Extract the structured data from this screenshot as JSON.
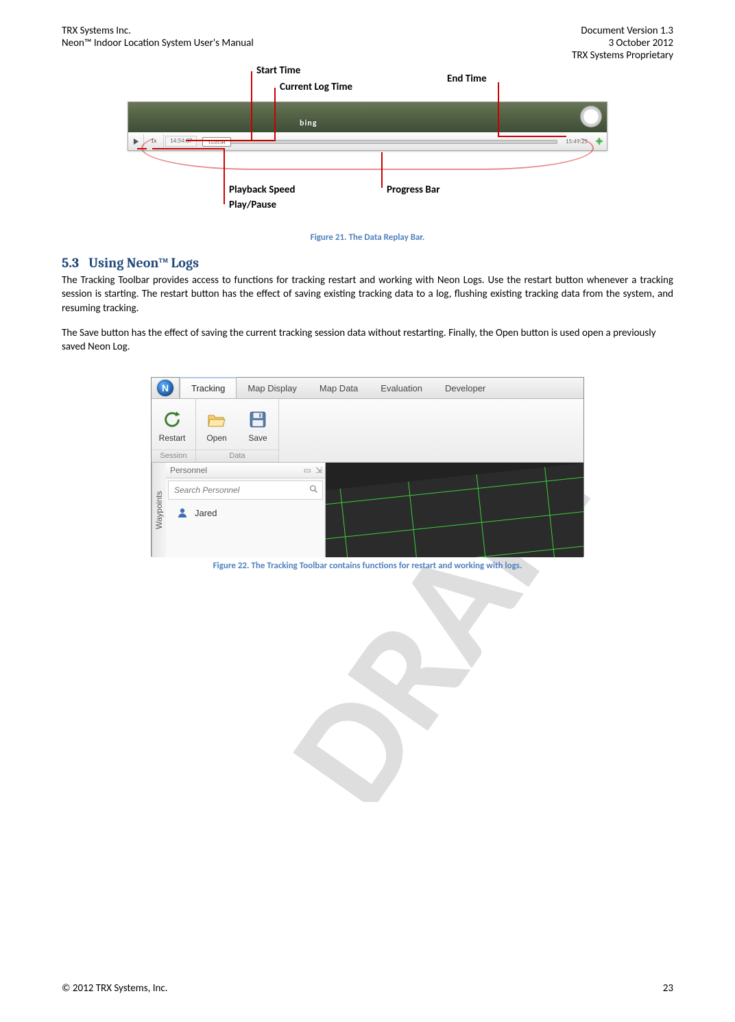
{
  "watermark": "DRAFT",
  "header": {
    "company": "TRX Systems Inc.",
    "doc_version": "Document Version 1.3",
    "title": "Neon™ Indoor Location System User's Manual",
    "date": "3 October 2012",
    "proprietary": "TRX Systems Proprietary"
  },
  "fig1": {
    "bing": "bing",
    "speed": "1x",
    "start_time": "14:54:37",
    "current_time": "15:01:04",
    "end_time": "15:49:25",
    "callouts": {
      "start": "Start Time",
      "current": "Current Log Time",
      "end": "End Time",
      "speed": "Playback Speed",
      "play": "Play/Pause",
      "progress": "Progress Bar"
    },
    "caption": "Figure 21.  The Data Replay Bar"
  },
  "section": {
    "num": "5.3",
    "title": "Using Neon™ Logs"
  },
  "body": {
    "p1": "The Tracking Toolbar provides access to functions for tracking restart and working with Neon Logs.  Use the restart button whenever a tracking session is starting.  The restart button has the effect of saving existing tracking data to a log, flushing existing tracking data from the system, and resuming tracking.",
    "p2": "The Save button has the effect of saving the current tracking session data without restarting.  Finally, the Open button is used open a previously saved Neon Log."
  },
  "fig2": {
    "orb": "N",
    "tabs": [
      "Tracking",
      "Map Display",
      "Map Data",
      "Evaluation",
      "Developer"
    ],
    "buttons": {
      "restart": "Restart",
      "open": "Open",
      "save": "Save"
    },
    "groups": {
      "session": "Session",
      "data": "Data"
    },
    "waypoints": "Waypoints",
    "personnel": {
      "title": "Personnel",
      "search_placeholder": "Search Personnel",
      "items": [
        "Jared"
      ]
    },
    "caption": "Figure 22.  The Tracking Toolbar contains functions for restart and working with logs."
  },
  "footer": {
    "copyright": "© 2012 TRX Systems, Inc.",
    "page": "23"
  }
}
